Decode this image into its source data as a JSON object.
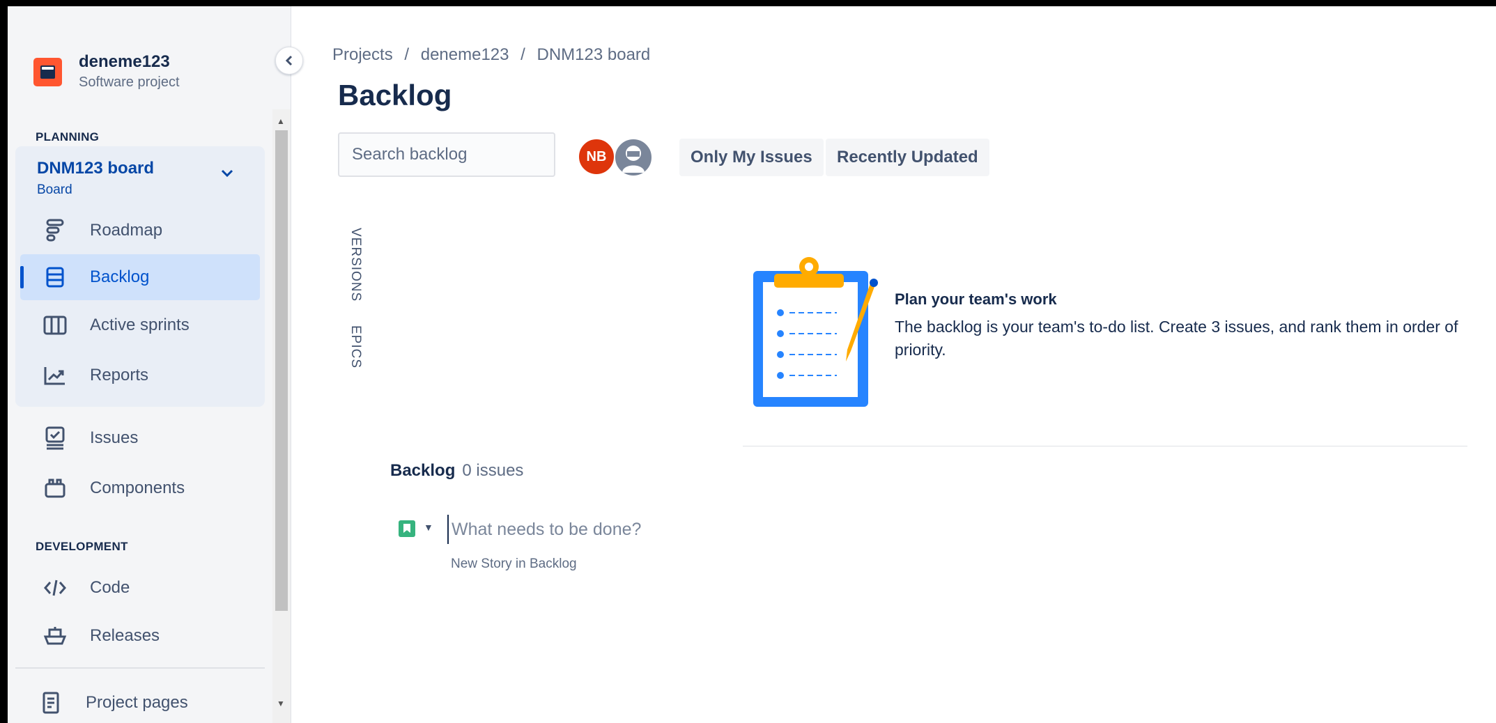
{
  "project": {
    "name": "deneme123",
    "type": "Software project"
  },
  "sidebar": {
    "planning_title": "PLANNING",
    "board": {
      "name": "DNM123 board",
      "sub": "Board"
    },
    "planning_items": [
      {
        "label": "Roadmap",
        "icon": "roadmap-icon"
      },
      {
        "label": "Backlog",
        "icon": "backlog-icon",
        "active": true
      },
      {
        "label": "Active sprints",
        "icon": "columns-icon"
      },
      {
        "label": "Reports",
        "icon": "chart-icon"
      }
    ],
    "other_items": [
      {
        "label": "Issues",
        "icon": "issues-icon"
      },
      {
        "label": "Components",
        "icon": "components-icon"
      }
    ],
    "development_title": "DEVELOPMENT",
    "dev_items": [
      {
        "label": "Code",
        "icon": "code-icon"
      },
      {
        "label": "Releases",
        "icon": "ship-icon"
      }
    ],
    "footer_items": [
      {
        "label": "Project pages",
        "icon": "page-icon"
      }
    ]
  },
  "breadcrumb": [
    "Projects",
    "/",
    "deneme123",
    "/",
    "DNM123 board"
  ],
  "page_title": "Backlog",
  "search": {
    "placeholder": "Search backlog"
  },
  "avatars": {
    "user_initials": "NB"
  },
  "filters": {
    "only_my_issues": "Only My Issues",
    "recently_updated": "Recently Updated"
  },
  "side_tabs": {
    "versions": "VERSIONS",
    "epics": "EPICS"
  },
  "empty_state": {
    "title": "Plan your team's work",
    "text": "The backlog is your team's to-do list. Create 3 issues, and rank them in order of priority."
  },
  "backlog": {
    "title": "Backlog",
    "count": "0 issues",
    "create_placeholder": "What needs to be done?",
    "create_hint": "New Story in Backlog"
  },
  "colors": {
    "accent": "#0052cc",
    "avatar_nb": "#de350b",
    "story": "#36b37e",
    "project_avatar": "#ff5630"
  }
}
